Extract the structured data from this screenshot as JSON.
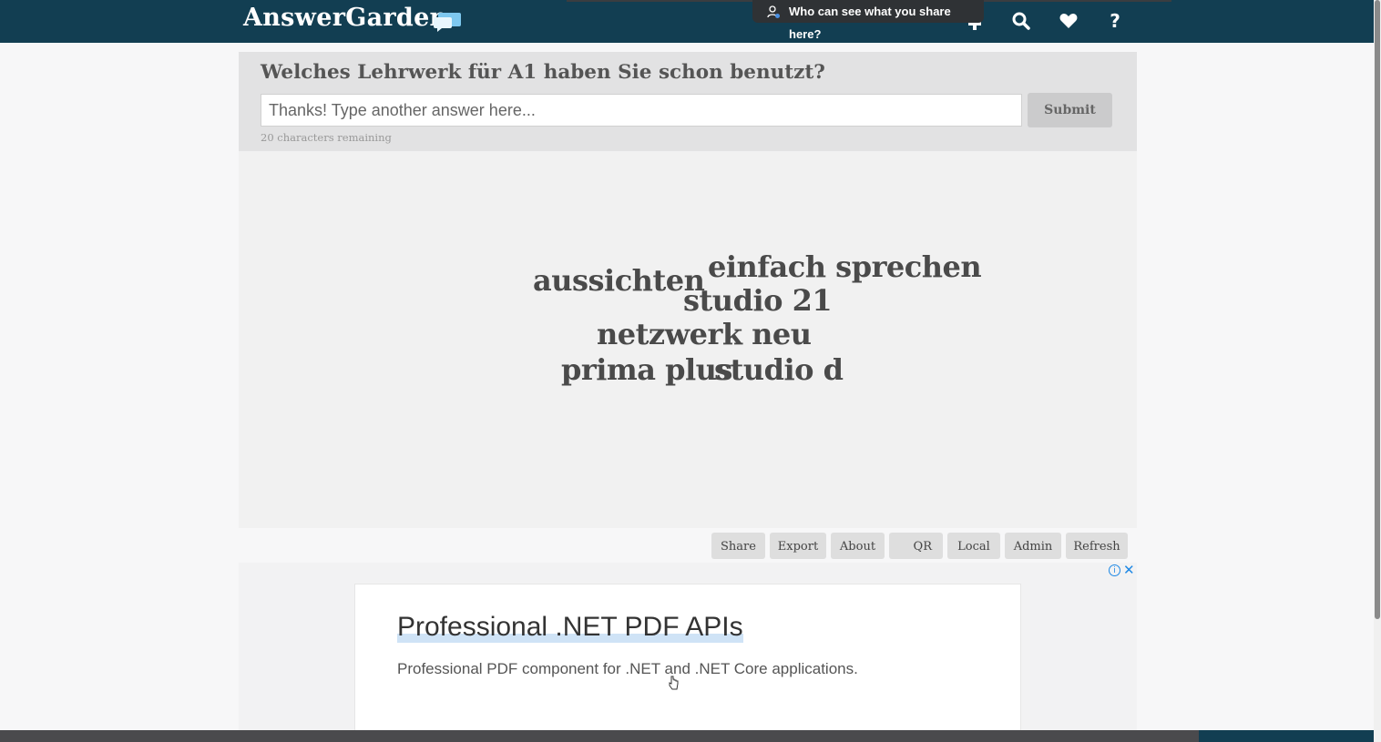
{
  "header": {
    "logo_text": "AnswerGarden",
    "share_tooltip": "Who can see what you share here?",
    "icons": [
      "add-icon",
      "search-icon",
      "heart-icon",
      "help-icon"
    ]
  },
  "garden": {
    "question": "Welches Lehrwerk für A1 haben Sie schon benutzt?",
    "input_placeholder": "Thanks! Type another answer here...",
    "submit_label": "Submit",
    "remaining": "20 characters remaining",
    "words": [
      "einfach sprechen",
      "aussichten",
      "studio 21",
      "netzwerk neu",
      "prima plus",
      "studio d"
    ]
  },
  "actions": {
    "share": "Share",
    "export": "Export",
    "about": "About",
    "qr": "QR",
    "local": "Local",
    "admin": "Admin",
    "refresh": "Refresh"
  },
  "ad": {
    "title": "Professional .NET PDF APIs",
    "description": "Professional PDF component for .NET and .NET Core applications."
  },
  "colors": {
    "header_bg": "#123e52",
    "panel_bg": "#e2e2e3",
    "ad_link": "#1e88e5"
  }
}
